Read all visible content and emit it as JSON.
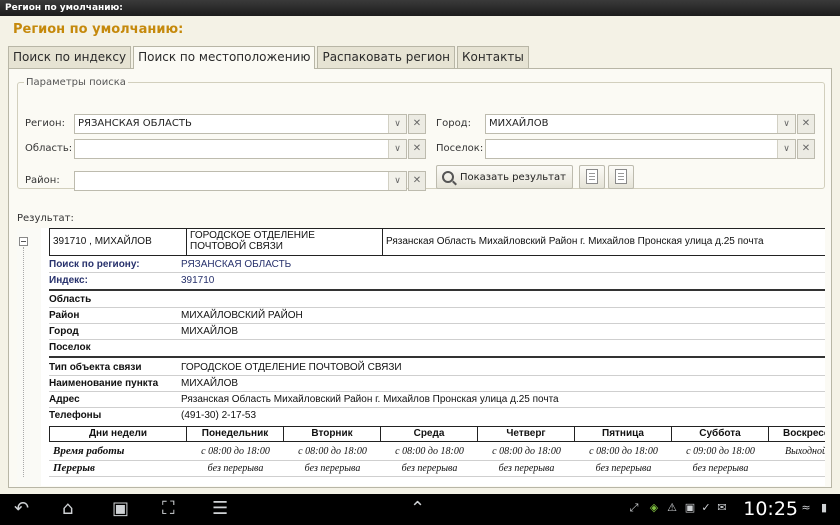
{
  "window": {
    "title": "Регион по умолчанию:"
  },
  "header": {
    "title": "Регион по умолчанию:"
  },
  "tabs": [
    {
      "label": "Поиск по индексу"
    },
    {
      "label": "Поиск по местоположению"
    },
    {
      "label": "Распаковать регион"
    },
    {
      "label": "Контакты"
    }
  ],
  "params": {
    "legend": "Параметры поиска",
    "region_label": "Регион:",
    "region_value": "РЯЗАНСКАЯ ОБЛАСТЬ",
    "oblast_label": "Область:",
    "oblast_value": "",
    "rayon_label": "Район:",
    "rayon_value": "",
    "city_label": "Город:",
    "city_value": "МИХАЙЛОВ",
    "village_label": "Поселок:",
    "village_value": "",
    "show_button": "Показать результат"
  },
  "result": {
    "label": "Результат:",
    "header_row": {
      "code_city": "391710 , МИХАЙЛОВ",
      "office_type_line1": "ГОРОДСКОЕ ОТДЕЛЕНИЕ",
      "office_type_line2": "ПОЧТОВОЙ СВЯЗИ",
      "address": "Рязанская Область Михайловский Район г. Михайлов Пронская улица д.25   почта"
    },
    "search_region_label": "Поиск по региону:",
    "search_region_value": "РЯЗАНСКАЯ ОБЛАСТЬ",
    "index_label": "Индекс:",
    "index_value": "391710",
    "oblast_label": "Область",
    "oblast_value": "",
    "rayon_label": "Район",
    "rayon_value": "МИХАЙЛОВСКИЙ РАЙОН",
    "city_label": "Город",
    "city_value": "МИХАЙЛОВ",
    "village_label": "Поселок",
    "village_value": "",
    "obj_type_label": "Тип объекта связи",
    "obj_type_value": "ГОРОДСКОЕ ОТДЕЛЕНИЕ ПОЧТОВОЙ СВЯЗИ",
    "point_name_label": "Наименование пункта",
    "point_name_value": "МИХАЙЛОВ",
    "address_label": "Адрес",
    "address_value": "Рязанская Область Михайловский Район г. Михайлов Пронская улица д.25   почта",
    "phones_label": "Телефоны",
    "phones_value": "(491-30) 2-17-53",
    "schedule": {
      "days_header": "Дни недели",
      "days": [
        "Понедельник",
        "Вторник",
        "Среда",
        "Четверг",
        "Пятница",
        "Суббота",
        "Воскресенье"
      ],
      "work_label": "Время работы",
      "work": [
        "с 08:00 до 18:00",
        "с 08:00 до 18:00",
        "с 08:00 до 18:00",
        "с 08:00 до 18:00",
        "с 08:00 до 18:00",
        "с 09:00 до 18:00",
        "Выходной"
      ],
      "break_label": "Перерыв",
      "breaks": [
        "без перерыва",
        "без перерыва",
        "без перерыва",
        "без перерыва",
        "без перерыва",
        "без перерыва",
        ""
      ]
    }
  },
  "statusbar": {
    "time": "10:25"
  }
}
